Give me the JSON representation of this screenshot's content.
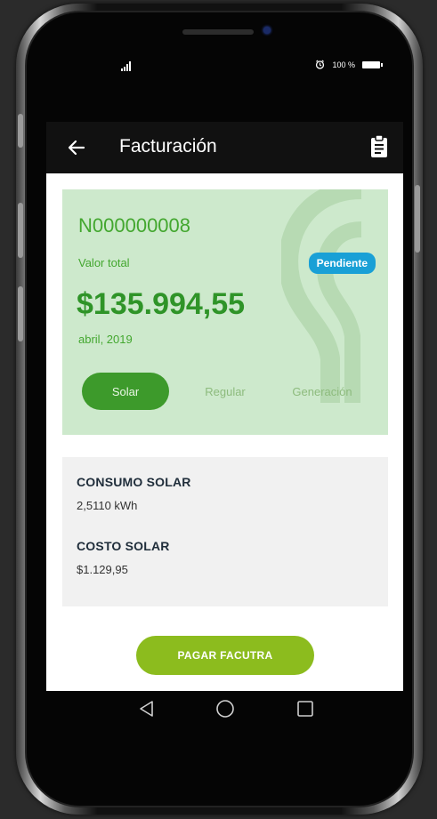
{
  "status_bar": {
    "battery_text": "100 %",
    "signal_icon": "signal-icon",
    "alarm_icon": "alarm-icon"
  },
  "app_bar": {
    "title": "Facturación",
    "back_icon": "arrow-left-icon",
    "action_icon": "clipboard-icon"
  },
  "invoice": {
    "number": "N000000008",
    "total_label": "Valor total",
    "status": "Pendiente",
    "amount": "$135.994,55",
    "period": "abril, 2019",
    "colors": {
      "card_bg": "#cde9cc",
      "accent": "#43a72f",
      "badge": "#19a0d6"
    }
  },
  "tabs": [
    {
      "label": "Solar",
      "active": true
    },
    {
      "label": "Regular",
      "active": false
    },
    {
      "label": "Generación",
      "active": false
    }
  ],
  "details": {
    "consumo_label": "CONSUMO SOLAR",
    "consumo_value": "2,5110 kWh",
    "costo_label": "COSTO SOLAR",
    "costo_value": "$1.129,95"
  },
  "pay_button": {
    "label": "PAGAR FACUTRA",
    "color": "#8cbc1e"
  },
  "nav_bar": {
    "back": "triangle-back-icon",
    "home": "circle-home-icon",
    "recents": "square-recents-icon"
  }
}
